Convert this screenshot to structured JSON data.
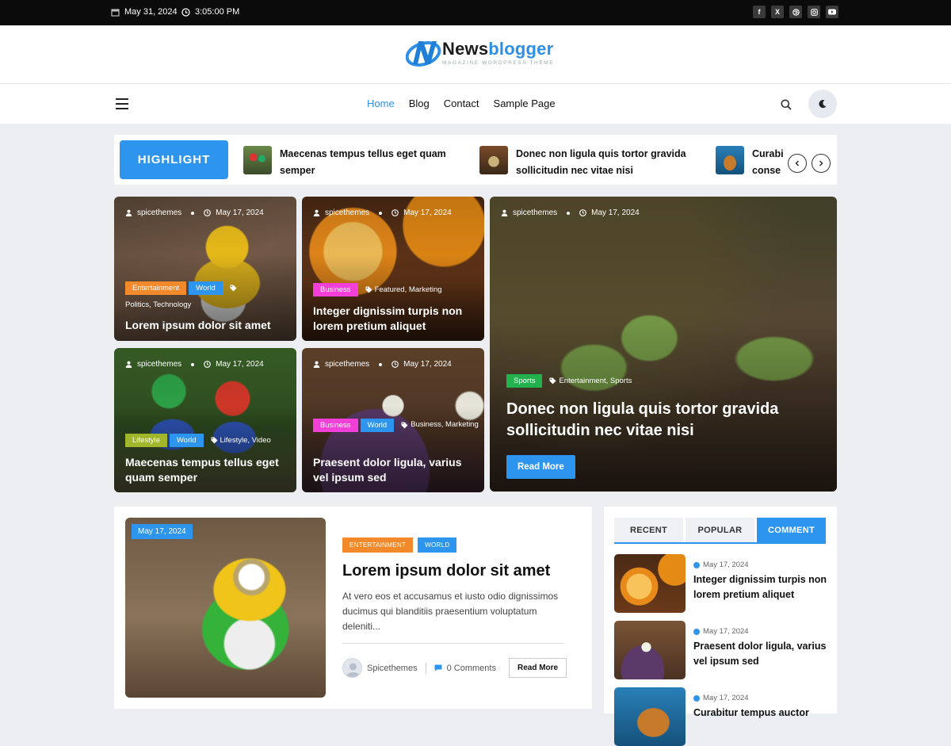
{
  "topbar": {
    "date": "May 31, 2024",
    "time": "3:05:00 PM",
    "social": [
      "facebook-icon",
      "x-icon",
      "dribbble-icon",
      "instagram-icon",
      "youtube-icon"
    ]
  },
  "logo": {
    "name_part1": "News",
    "name_part2": "blogger",
    "tagline": "MAGAZINE WORDPRESS THEME"
  },
  "nav": {
    "items": [
      {
        "label": "Home",
        "active": true
      },
      {
        "label": "Blog",
        "active": false
      },
      {
        "label": "Contact",
        "active": false
      },
      {
        "label": "Sample Page",
        "active": false
      }
    ]
  },
  "highlight": {
    "label": "HIGHLIGHT",
    "items": [
      {
        "title": "Maecenas tempus tellus eget quam semper"
      },
      {
        "title": "Donec non ligula quis tortor gravida sollicitudin nec vitae nisi"
      },
      {
        "title": "Curabi conse"
      }
    ]
  },
  "grid": {
    "cards": [
      {
        "author": "spicethemes",
        "date": "May 17, 2024",
        "tags": [
          {
            "label": "Entertainment",
            "color": "#f28a2b"
          },
          {
            "label": "World",
            "color": "#2e95ef"
          }
        ],
        "cats": "Politics, Technology",
        "title": "Lorem ipsum dolor sit amet"
      },
      {
        "author": "spicethemes",
        "date": "May 17, 2024",
        "tags": [
          {
            "label": "Business",
            "color": "#f13fd7"
          }
        ],
        "cats": "Featured, Marketing",
        "title": "Integer dignissim turpis non lorem pretium aliquet"
      },
      {
        "author": "spicethemes",
        "date": "May 17, 2024",
        "tags": [
          {
            "label": "Lifestyle",
            "color": "#a1b62b"
          },
          {
            "label": "World",
            "color": "#2e95ef"
          }
        ],
        "cats": "Lifestyle, Video",
        "title": "Maecenas tempus tellus eget quam semper"
      },
      {
        "author": "spicethemes",
        "date": "May 17, 2024",
        "tags": [
          {
            "label": "Business",
            "color": "#f13fd7"
          },
          {
            "label": "World",
            "color": "#2e95ef"
          }
        ],
        "cats": "Business, Marketing",
        "title": "Praesent dolor ligula, varius vel ipsum sed"
      }
    ],
    "big": {
      "author": "spicethemes",
      "date": "May 17, 2024",
      "tags": [
        {
          "label": "Sports",
          "color": "#22b14c"
        }
      ],
      "cats": "Entertainment, Sports",
      "title": "Donec non ligula quis tortor gravida sollicitudin nec vitae nisi",
      "read_more": "Read More"
    }
  },
  "post": {
    "date": "May 17, 2024",
    "tags": [
      {
        "label": "ENTERTAINMENT",
        "color": "#f28a2b"
      },
      {
        "label": "WORLD",
        "color": "#2e95ef"
      }
    ],
    "title": "Lorem ipsum dolor sit amet",
    "excerpt": "At vero eos et accusamus et iusto odio dignissimos ducimus qui blanditiis praesentium voluptatum deleniti...",
    "author": "Spicethemes",
    "comments": "0 Comments",
    "read_more": "Read More"
  },
  "sidebar": {
    "tabs": [
      {
        "label": "RECENT",
        "active": false
      },
      {
        "label": "POPULAR",
        "active": false
      },
      {
        "label": "COMMENT",
        "active": true
      }
    ],
    "items": [
      {
        "date": "May 17, 2024",
        "title": "Integer dignissim turpis non lorem pretium aliquet"
      },
      {
        "date": "May 17, 2024",
        "title": "Praesent dolor ligula, varius vel ipsum sed"
      },
      {
        "date": "May 17, 2024",
        "title": "Curabitur tempus auctor"
      }
    ]
  }
}
